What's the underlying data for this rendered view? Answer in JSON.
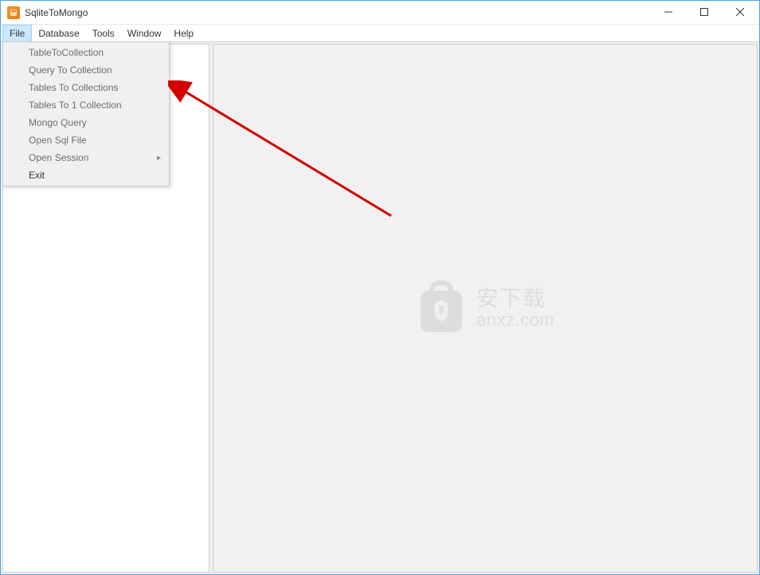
{
  "window": {
    "title": "SqliteToMongo"
  },
  "menubar": {
    "items": [
      {
        "label": "File",
        "active": true
      },
      {
        "label": "Database",
        "active": false
      },
      {
        "label": "Tools",
        "active": false
      },
      {
        "label": "Window",
        "active": false
      },
      {
        "label": "Help",
        "active": false
      }
    ]
  },
  "file_menu": {
    "items": [
      {
        "label": "TableToCollection",
        "has_submenu": false,
        "bold": false
      },
      {
        "label": "Query To Collection",
        "has_submenu": false,
        "bold": false
      },
      {
        "label": "Tables To Collections",
        "has_submenu": false,
        "bold": false
      },
      {
        "label": "Tables To 1 Collection",
        "has_submenu": false,
        "bold": false
      },
      {
        "label": "Mongo Query",
        "has_submenu": false,
        "bold": false
      },
      {
        "label": "Open Sql File",
        "has_submenu": false,
        "bold": false
      },
      {
        "label": "Open Session",
        "has_submenu": true,
        "bold": false
      },
      {
        "label": "Exit",
        "has_submenu": false,
        "bold": true
      }
    ]
  },
  "watermark": {
    "line1": "安下载",
    "line2": "anxz.com"
  }
}
